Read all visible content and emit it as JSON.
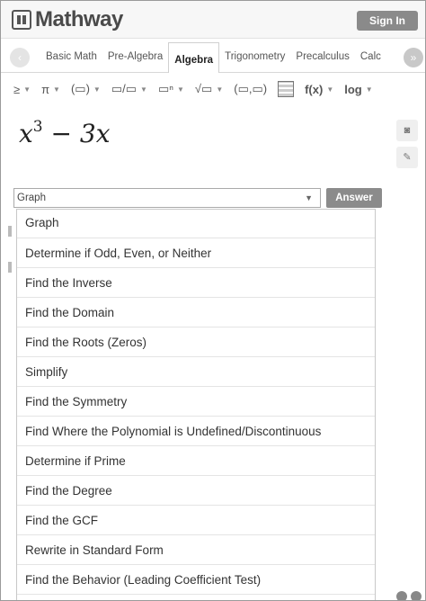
{
  "header": {
    "logo_text": "Mathway",
    "signin_label": "Sign In"
  },
  "tabs": {
    "items": [
      "Basic Math",
      "Pre-Algebra",
      "Algebra",
      "Trigonometry",
      "Precalculus",
      "Calc"
    ],
    "active": "Algebra"
  },
  "toolbar": {
    "items": [
      "≥",
      "π",
      "(▭)",
      "▭/▭",
      "▭ⁿ",
      "√▭",
      "(▭,▭)",
      "",
      "f(x)",
      "log"
    ]
  },
  "expression": {
    "base": "x",
    "exponent": "3",
    "rest": " − 3x"
  },
  "action_select": {
    "value": "Graph"
  },
  "answer_label": "Answer",
  "dropdown": {
    "options": [
      "Graph",
      "Determine if Odd, Even, or Neither",
      "Find the Inverse",
      "Find the Domain",
      "Find the Roots (Zeros)",
      "Simplify",
      "Find the Symmetry",
      "Find Where the Polynomial is Undefined/Discontinuous",
      "Determine if Prime",
      "Find the Degree",
      "Find the GCF",
      "Rewrite in Standard Form",
      "Find the Behavior (Leading Coefficient Test)"
    ]
  }
}
